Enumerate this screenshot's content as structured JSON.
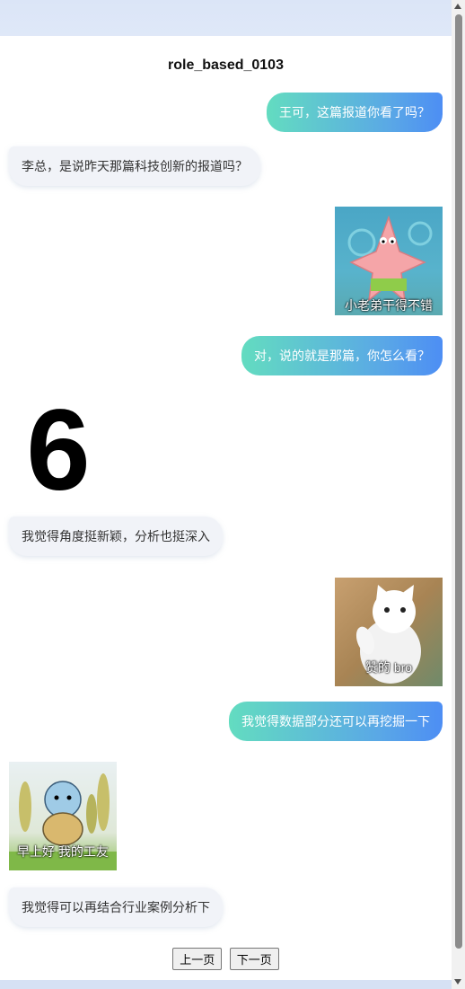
{
  "chat": {
    "title": "role_based_0103",
    "messages": [
      {
        "text": "王可，这篇报道你看了吗？"
      },
      {
        "text": "李总，是说昨天那篇科技创新的报道吗？"
      },
      {
        "sticker_caption": "小老弟干得不错"
      },
      {
        "text": "对，说的就是那篇，你怎么看？"
      },
      {
        "sticker_caption": "6"
      },
      {
        "text": "我觉得角度挺新颖，分析也挺深入"
      },
      {
        "sticker_caption": "赞的 bro"
      },
      {
        "text": "我觉得数据部分还可以再挖掘一下"
      },
      {
        "sticker_caption": "早上好 我的工友"
      },
      {
        "text": "我觉得可以再结合行业案例分析下"
      }
    ]
  },
  "nav": {
    "prev_label": "上一页",
    "next_label": "下一页"
  },
  "colors": {
    "outgoing_start": "#63dcc0",
    "outgoing_end": "#4d8ef4",
    "incoming_bg": "#f1f3f8"
  }
}
